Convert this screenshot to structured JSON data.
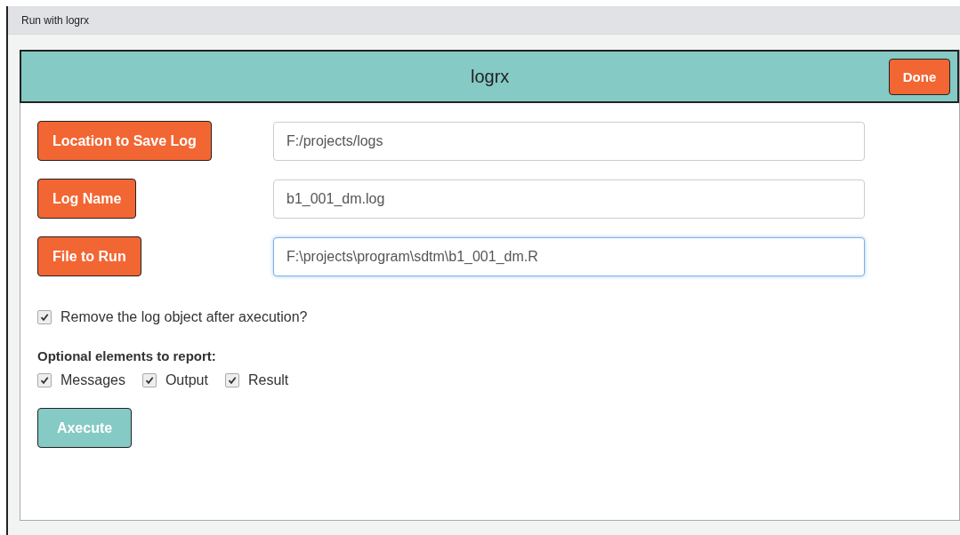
{
  "window": {
    "title": "Run with logrx"
  },
  "header": {
    "title": "logrx",
    "done_button": "Done"
  },
  "rows": [
    {
      "button": "Location to Save Log",
      "value": "F:/projects/logs",
      "focused": false
    },
    {
      "button": "Log Name",
      "value": "b1_001_dm.log",
      "focused": false
    },
    {
      "button": "File to Run",
      "value": "F:\\projects\\program\\sdtm\\b1_001_dm.R",
      "focused": true
    }
  ],
  "remove_option": {
    "label": "Remove the log object after axecution?",
    "checked": true
  },
  "optional": {
    "heading": "Optional elements to report:",
    "items": [
      {
        "label": "Messages",
        "checked": true
      },
      {
        "label": "Output",
        "checked": true
      },
      {
        "label": "Result",
        "checked": true
      }
    ]
  },
  "execute_button": "Axecute"
}
